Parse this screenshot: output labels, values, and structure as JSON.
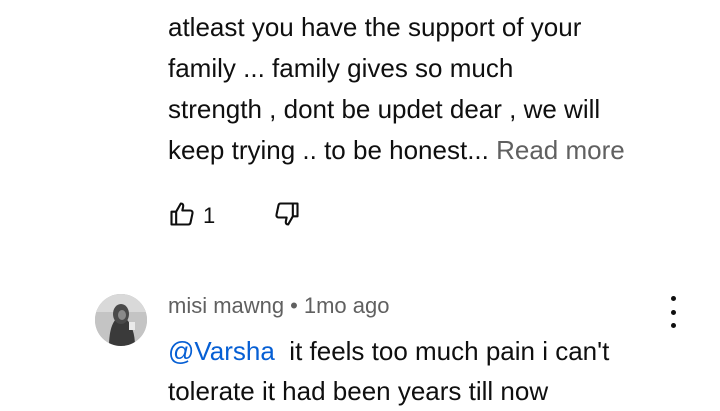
{
  "previous_comment": {
    "lines": [
      "atleast you have the support of your",
      "family ... family gives so much",
      "strength , dont be updet dear , we will",
      "keep trying .. to be honest..."
    ],
    "read_more_label": "Read more",
    "like_count": "1",
    "icons": {
      "like": "thumbs-up-icon",
      "dislike": "thumbs-down-icon"
    }
  },
  "reply": {
    "author": "misi mawng",
    "separator": "•",
    "time": "1mo ago",
    "mention": "@Varsha",
    "text_first": "  it feels too much pain i can't",
    "text_second": "tolerate it had been years till now",
    "icons": {
      "menu": "more-vertical-icon"
    }
  },
  "colors": {
    "text_primary": "#0f0f0f",
    "text_secondary": "#606060",
    "link": "#065fd4",
    "background": "#ffffff"
  }
}
